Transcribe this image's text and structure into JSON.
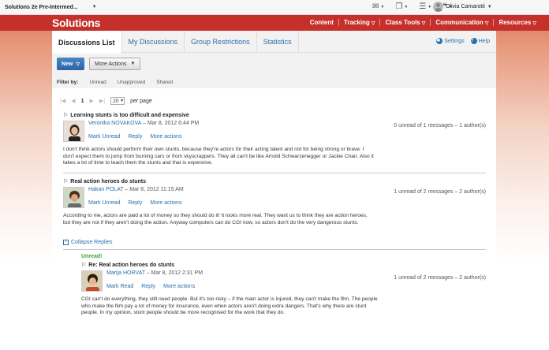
{
  "topbar": {
    "course": "Solutions 2e Pre-Intermed...",
    "user": "Olivia Camarotti"
  },
  "nav": {
    "brand": "Solutions",
    "items": [
      "Content",
      "Tracking",
      "Class Tools",
      "Communication",
      "Resources"
    ]
  },
  "tabs": [
    "Discussions List",
    "My Discussions",
    "Group Restrictions",
    "Statistics"
  ],
  "toolbar_links": {
    "settings": "Settings",
    "help": "Help"
  },
  "buttons": {
    "new": "New",
    "more": "More Actions"
  },
  "filter": {
    "label": "Filter by:",
    "options": [
      "Unread",
      "Unapproved",
      "Shared"
    ]
  },
  "pager": {
    "page": "1",
    "per_page_value": "20",
    "per_page_label": "per page"
  },
  "posts": [
    {
      "title": "Learning stunts is too difficult and expensive",
      "author": "Veronika NOVAKOVA",
      "date": "– Mar 8, 2012 6:44 PM",
      "actions": [
        "Mark Unread",
        "Reply",
        "More actions"
      ],
      "status": "0 unread of 1 messages – 1 author(s)",
      "body": "I don't think actors should perform their own stunts, because they're actors for their acting talent and not for being strong or brave. I don't expect them to jump from burning cars or from skyscrappers. They all can't be like Arnold Schwarzenegger or Jackie Chan. Also it takes a lot of time to teach them the stunts and that is expensive."
    },
    {
      "title": "Real action heroes do stunts",
      "author": "Hakan POLAT",
      "date": "– Mar 8, 2012 11:15 AM",
      "actions": [
        "Mark Unread",
        "Reply",
        "More actions"
      ],
      "status": "1 unread of 2 messages – 2 author(s)",
      "body": "According to me, actors are paid a lot of money so they should do it! It looks more real. They want us to think they are action heroes, but they are not if they aren't doing the action. Anyway computers can do CGI now, so actors don't do the very dangerous stunts.",
      "collapse": "Collapse Replies"
    }
  ],
  "reply": {
    "unread": "Unread!",
    "title": "Re: Real action heroes do stunts",
    "author": "Marija HORVAT",
    "date": "– Mar 8, 2012 2:31 PM",
    "actions": [
      "Mark Read",
      "Reply",
      "More actions"
    ],
    "status": "1 unread of 2 messages – 2 author(s)",
    "body": "CGI can't do everything, they still need people. But it's too risky – if the main actor is injured, they can't make the film. The people who make the film pay a lot of money for insurance, even when actors aren't doing extra dangers. That's why there are stunt people. In my opinion, stunt people should be more recognised for the work that they do."
  },
  "colors": {
    "brand_red": "#c5302a",
    "link_blue": "#2a6fab",
    "button_blue": "#3a76b6",
    "unread_green": "#3aa53a"
  }
}
